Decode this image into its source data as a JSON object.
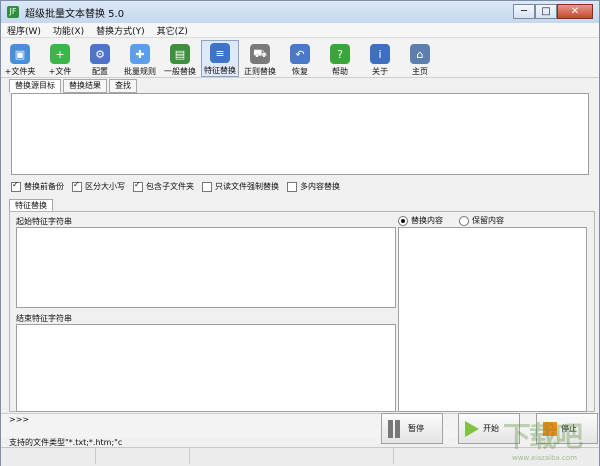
{
  "window": {
    "title": "超级批量文本替换 5.0",
    "icon": "JF",
    "controls": [
      "─",
      "□",
      "✕"
    ]
  },
  "menu": [
    "程序(W)",
    "功能(X)",
    "替换方式(Y)",
    "其它(Z)"
  ],
  "toolbar": [
    {
      "label": "+文件夹",
      "icon": "folder-add-icon",
      "color": "#4b8ed8"
    },
    {
      "label": "+文件",
      "icon": "file-add-icon",
      "color": "#3cb54a"
    },
    {
      "label": "配置",
      "icon": "gear-icon",
      "color": "#4f73c8"
    },
    {
      "label": "批量规则",
      "icon": "puzzle-icon",
      "color": "#5b9ee9"
    },
    {
      "label": "一般替换",
      "icon": "document-icon",
      "color": "#3e8f3e"
    },
    {
      "label": "特征替换",
      "icon": "network-icon",
      "color": "#3d73c9"
    },
    {
      "label": "正则替换",
      "icon": "cart-icon",
      "color": "#7a7a7a"
    },
    {
      "label": "恢复",
      "icon": "undo-icon",
      "color": "#4a79c8"
    },
    {
      "label": "帮助",
      "icon": "question-icon",
      "color": "#3aa53a"
    },
    {
      "label": "关于",
      "icon": "info-icon",
      "color": "#3f6fc1"
    },
    {
      "label": "主页",
      "icon": "home-icon",
      "color": "#5d7fb0"
    }
  ],
  "top_tabs": [
    "替换源目标",
    "替换结果",
    "查找"
  ],
  "options": [
    {
      "label": "替换前备份",
      "checked": true
    },
    {
      "label": "区分大小写",
      "checked": true
    },
    {
      "label": "包含子文件夹",
      "checked": true
    },
    {
      "label": "只读文件强制替换",
      "checked": false
    },
    {
      "label": "多内容替换",
      "checked": false
    }
  ],
  "feature_tab": "特征替换",
  "left_panel": {
    "start_label": "起始特征字符串",
    "end_label": "结束特征字符串"
  },
  "right_panel": {
    "radio_replace": "替换内容",
    "radio_keep": "保留内容",
    "selected": "替换内容"
  },
  "bottom": {
    "prompt": ">>>",
    "status": "支持的文件类型\"*.txt;*.htm;\"c",
    "pause": "暂停",
    "start": "开始",
    "stop": "停止"
  },
  "watermark": {
    "brand": "下载吧",
    "site": "www.xiazaiba.com"
  }
}
